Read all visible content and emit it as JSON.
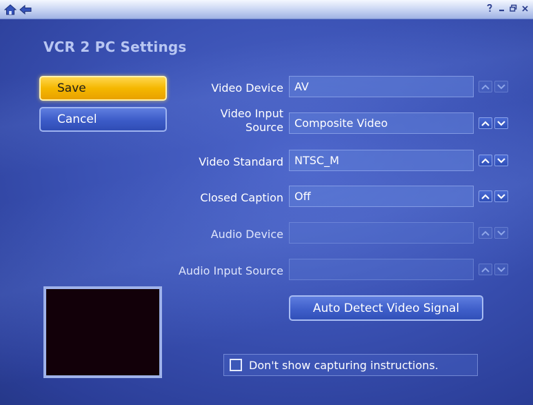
{
  "title": "VCR 2 PC Settings",
  "buttons": {
    "save": "Save",
    "cancel": "Cancel",
    "auto_detect": "Auto Detect Video Signal"
  },
  "settings": [
    {
      "label": "Video Device",
      "value": "AV",
      "enabled": false
    },
    {
      "label_line1": "Video Input",
      "label_line2": "Source",
      "value": "Composite Video",
      "enabled": true
    },
    {
      "label": "Video Standard",
      "value": "NTSC_M",
      "enabled": true
    },
    {
      "label": "Closed Caption",
      "value": "Off",
      "enabled": true
    },
    {
      "label": "Audio Device",
      "value": "",
      "enabled": false
    },
    {
      "label": "Audio Input Source",
      "value": "",
      "enabled": false
    }
  ],
  "checkbox": {
    "label": "Don't show capturing instructions.",
    "checked": false
  },
  "icons": {
    "home": "home-icon",
    "back": "back-arrow-icon",
    "help": "help-icon",
    "minimize": "minimize-icon",
    "restore": "restore-icon",
    "close": "close-icon",
    "arrow_up": "chevron-up-icon",
    "arrow_down": "chevron-down-icon"
  },
  "colors": {
    "accent_save": "#f5b700",
    "background": "#3a51b3"
  }
}
